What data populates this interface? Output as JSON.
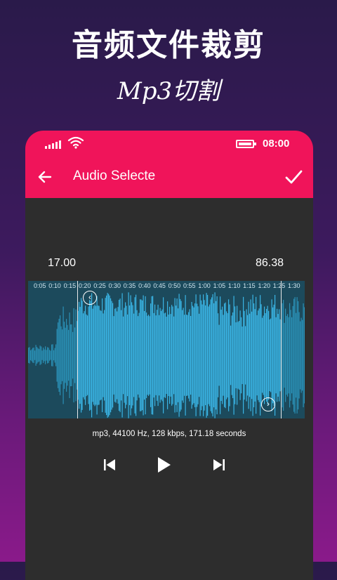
{
  "promo": {
    "title": "音频文件裁剪",
    "subtitle": "Mp3切割"
  },
  "status_bar": {
    "time": "08:00",
    "battery_level": 0.8,
    "signal_bars": 5
  },
  "app_bar": {
    "title": "Audio Selecte",
    "back_icon": "arrow-back-icon",
    "confirm_icon": "check-icon"
  },
  "editor": {
    "start_value": "17.00",
    "end_value": "86.38",
    "time_ticks": [
      "0:05",
      "0:10",
      "0:15",
      "0:20",
      "0:25",
      "0:30",
      "0:35",
      "0:40",
      "0:45",
      "0:50",
      "0:55",
      "1:00",
      "1:05",
      "1:10",
      "1:15",
      "1:20",
      "1:25",
      "1:30"
    ],
    "file_info": "mp3, 44100 Hz, 128 kbps, 171.18 seconds",
    "start_handle_icon": "chevron-left-circle-icon",
    "end_handle_icon": "chevron-right-circle-icon"
  },
  "playback": {
    "prev_icon": "skip-previous-icon",
    "play_icon": "play-icon",
    "next_icon": "skip-next-icon"
  },
  "colors": {
    "accent": "#f0145a",
    "waveform": "#3ab4e4",
    "waveform_dim": "#2a8fb4",
    "panel": "#2d2d2d"
  }
}
